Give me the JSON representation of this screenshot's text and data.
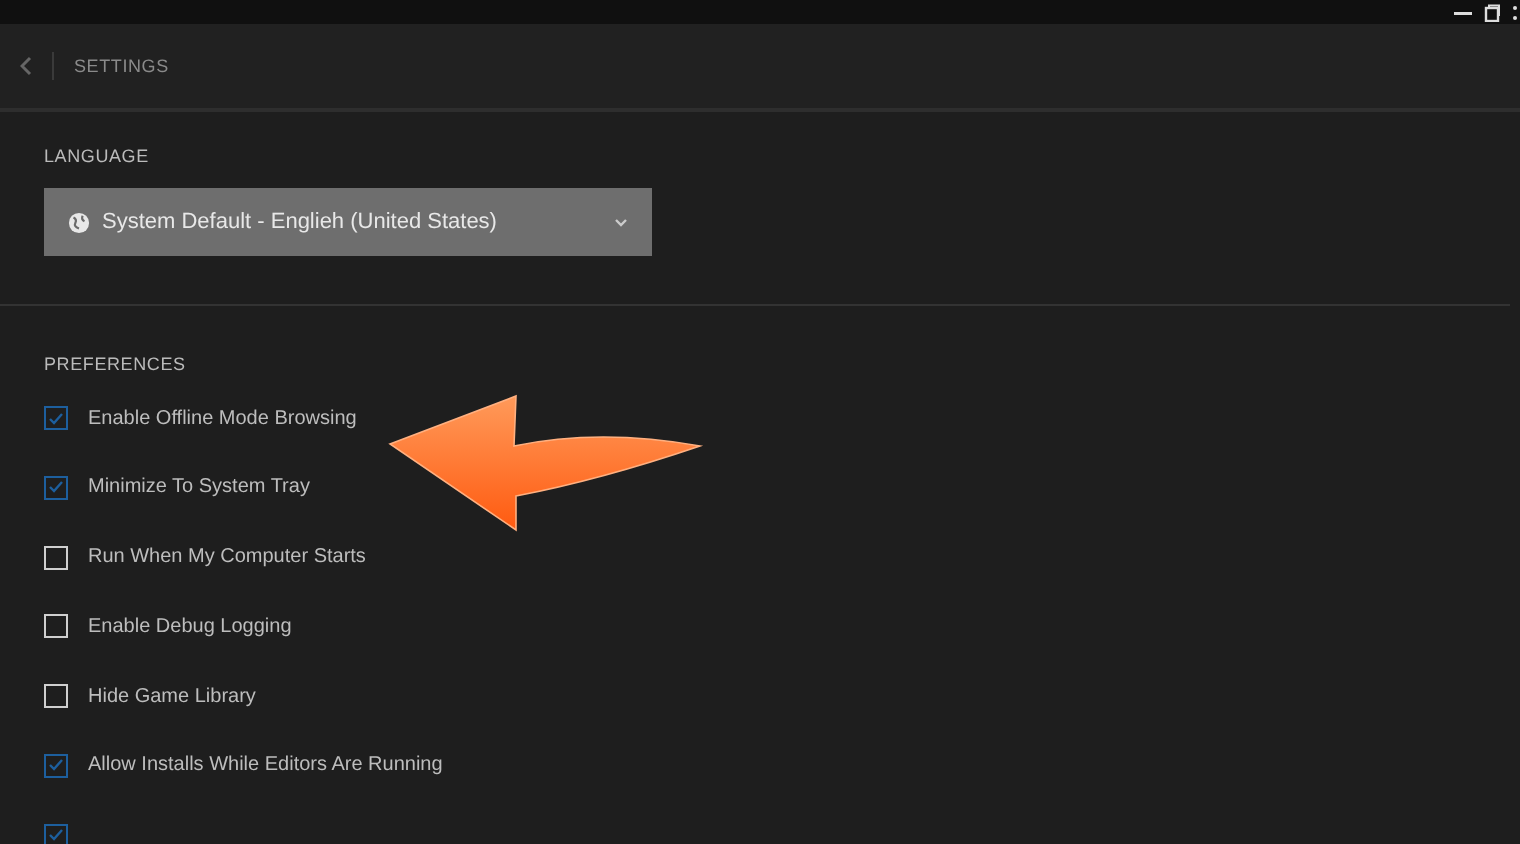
{
  "header": {
    "title": "SETTINGS"
  },
  "language": {
    "label": "LANGUAGE",
    "value": "System Default - Englieh (United States)"
  },
  "preferences": {
    "label": "PREFERENCES",
    "items": [
      {
        "label": "Enable Offline Mode Browsing",
        "checked": true
      },
      {
        "label": "Minimize To System Tray",
        "checked": true
      },
      {
        "label": "Run When My Computer Starts",
        "checked": false
      },
      {
        "label": "Enable Debug Logging",
        "checked": false
      },
      {
        "label": "Hide Game Library",
        "checked": false
      },
      {
        "label": "Allow Installs While Editors Are Running",
        "checked": true
      },
      {
        "checked": true
      }
    ]
  }
}
